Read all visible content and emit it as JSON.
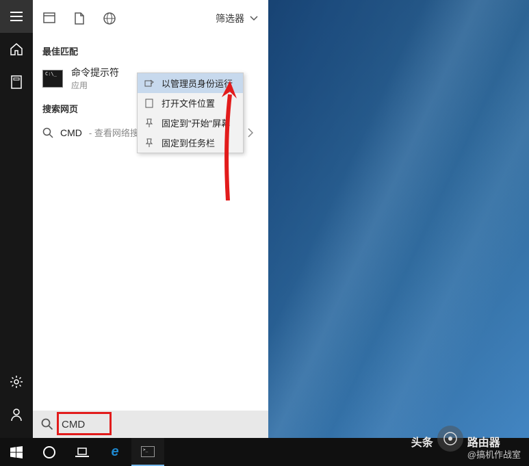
{
  "sidebar": {
    "items": [
      {
        "name": "menu"
      },
      {
        "name": "home"
      },
      {
        "name": "clipboard"
      }
    ],
    "bottom": [
      {
        "name": "settings"
      },
      {
        "name": "account"
      }
    ]
  },
  "header": {
    "filter_label": "筛选器"
  },
  "sections": {
    "best_match": "最佳匹配",
    "web": "搜索网页"
  },
  "results": {
    "cmd": {
      "title": "命令提示符",
      "subtitle": "应用"
    },
    "web": {
      "title": "CMD",
      "subtitle": "- 查看网络搜"
    }
  },
  "context_menu": {
    "run_admin": "以管理员身份运行",
    "open_location": "打开文件位置",
    "pin_start": "固定到\"开始\"屏幕",
    "pin_taskbar": "固定到任务栏"
  },
  "search": {
    "value": "CMD"
  },
  "watermark": {
    "brand": "头条",
    "account": "@搞机作战室",
    "title": "路由器"
  }
}
